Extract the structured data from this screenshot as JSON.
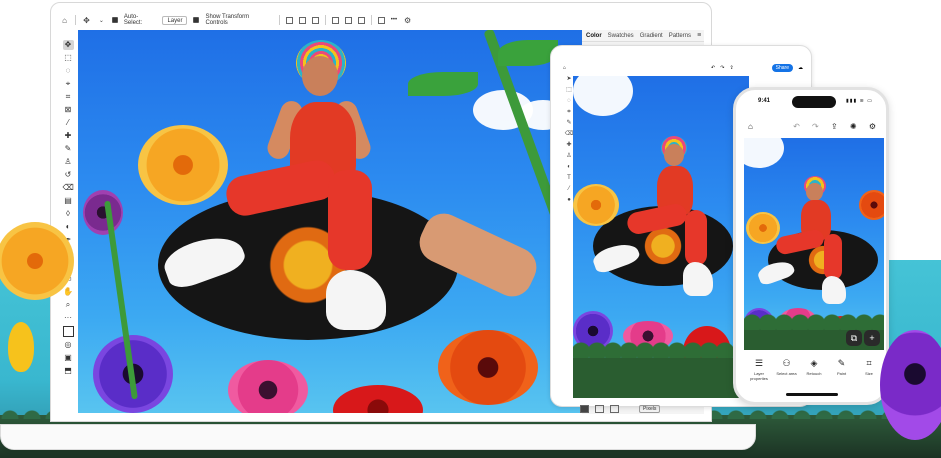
{
  "laptop": {
    "options_bar": {
      "auto_select_label": "Auto-Select:",
      "auto_select_value": "Layer",
      "transform_label": "Show Transform Controls",
      "more_label": "•••"
    },
    "panel": {
      "tabs": [
        "Color",
        "Swatches",
        "Gradient",
        "Patterns"
      ],
      "active_tab": "Color"
    }
  },
  "tablet": {
    "share_label": "Share",
    "units_value": "Pixels"
  },
  "phone": {
    "time": "9:41",
    "status": "▮▮▮ ≋ ▭",
    "tools": [
      {
        "label": "Layer properties",
        "icon": "sliders-icon"
      },
      {
        "label": "Select area",
        "icon": "select-subject-icon"
      },
      {
        "label": "Retouch",
        "icon": "retouch-icon"
      },
      {
        "label": "Paint",
        "icon": "brush-icon"
      },
      {
        "label": "Size",
        "icon": "crop-icon"
      }
    ]
  }
}
